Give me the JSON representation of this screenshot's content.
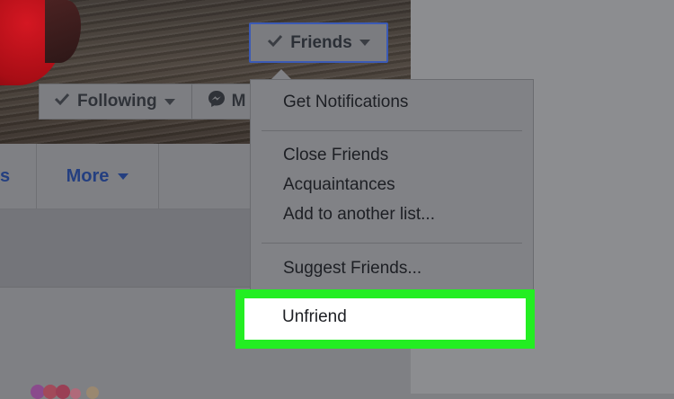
{
  "profile": {
    "friends_button": {
      "label": "Friends",
      "icon": "checkmark-icon"
    },
    "following_button": {
      "label": "Following",
      "icon": "checkmark-icon"
    },
    "message_button": {
      "label": "M",
      "icon": "messenger-icon"
    }
  },
  "nav": {
    "partial_tab_label": "s",
    "more_label": "More"
  },
  "dropdown": {
    "items": [
      {
        "label": "Get Notifications"
      },
      {
        "label": "Close Friends"
      },
      {
        "label": "Acquaintances"
      },
      {
        "label": "Add to another list..."
      },
      {
        "label": "Suggest Friends..."
      }
    ],
    "highlighted": {
      "label": "Unfriend",
      "highlight_color": "#23ee22"
    }
  },
  "colors": {
    "overlay": "#7f8083",
    "link_blue": "#243f80",
    "focus_border": "#3b5ab5"
  }
}
